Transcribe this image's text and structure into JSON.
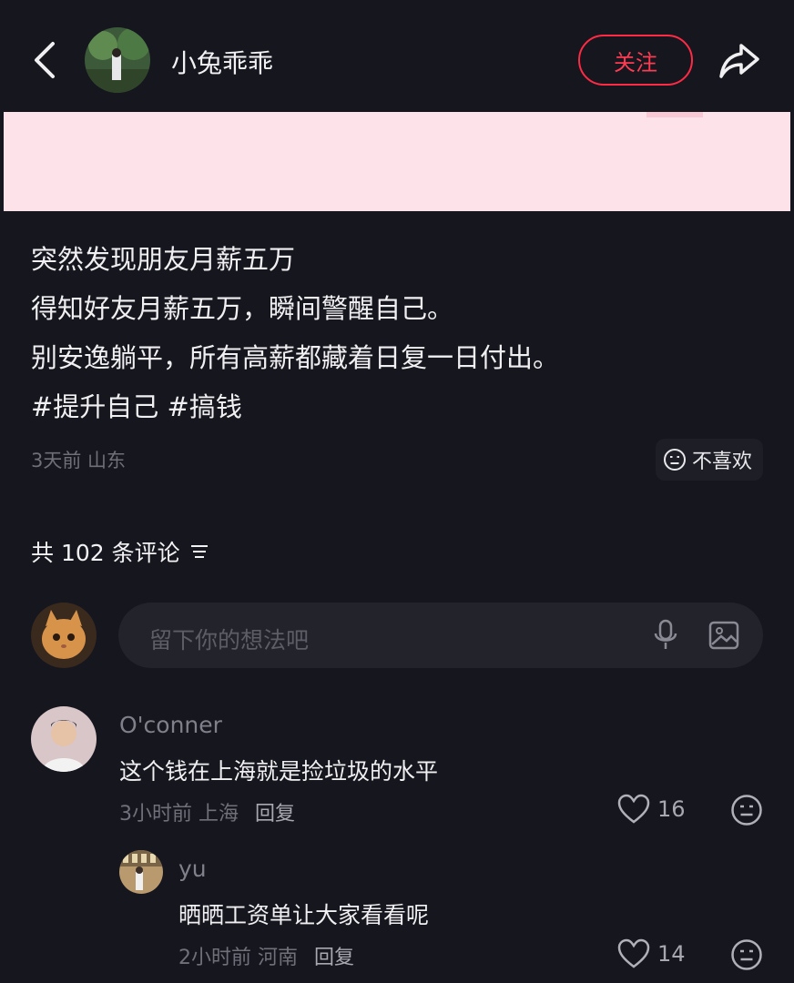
{
  "header": {
    "author_name": "小兔乖乖",
    "follow_label": "关注"
  },
  "post": {
    "lines": [
      "突然发现朋友月薪五万",
      "得知好友月薪五万，瞬间警醒自己。",
      "别安逸躺平，所有高薪都藏着日复一日付出。",
      "#提升自己 #搞钱"
    ],
    "meta": "3天前 山东",
    "dislike_label": "不喜欢"
  },
  "comments_header": {
    "count_label": "共 102 条评论"
  },
  "comment_input": {
    "placeholder": "留下你的想法吧"
  },
  "comments": [
    {
      "name": "O'conner",
      "text": "这个钱在上海就是捡垃圾的水平",
      "meta": "3小时前 上海",
      "reply_label": "回复",
      "likes": "16"
    },
    {
      "name": "yu",
      "text": "晒晒工资单让大家看看呢",
      "meta": "2小时前 河南",
      "reply_label": "回复",
      "likes": "14"
    }
  ],
  "colors": {
    "background": "#16161e",
    "follow_accent": "#ff2a44",
    "banner": "#fde3e9"
  },
  "icons": [
    "back-arrow-icon",
    "share-icon",
    "neutral-face-icon",
    "sort-icon",
    "microphone-icon",
    "image-icon",
    "heart-icon"
  ]
}
